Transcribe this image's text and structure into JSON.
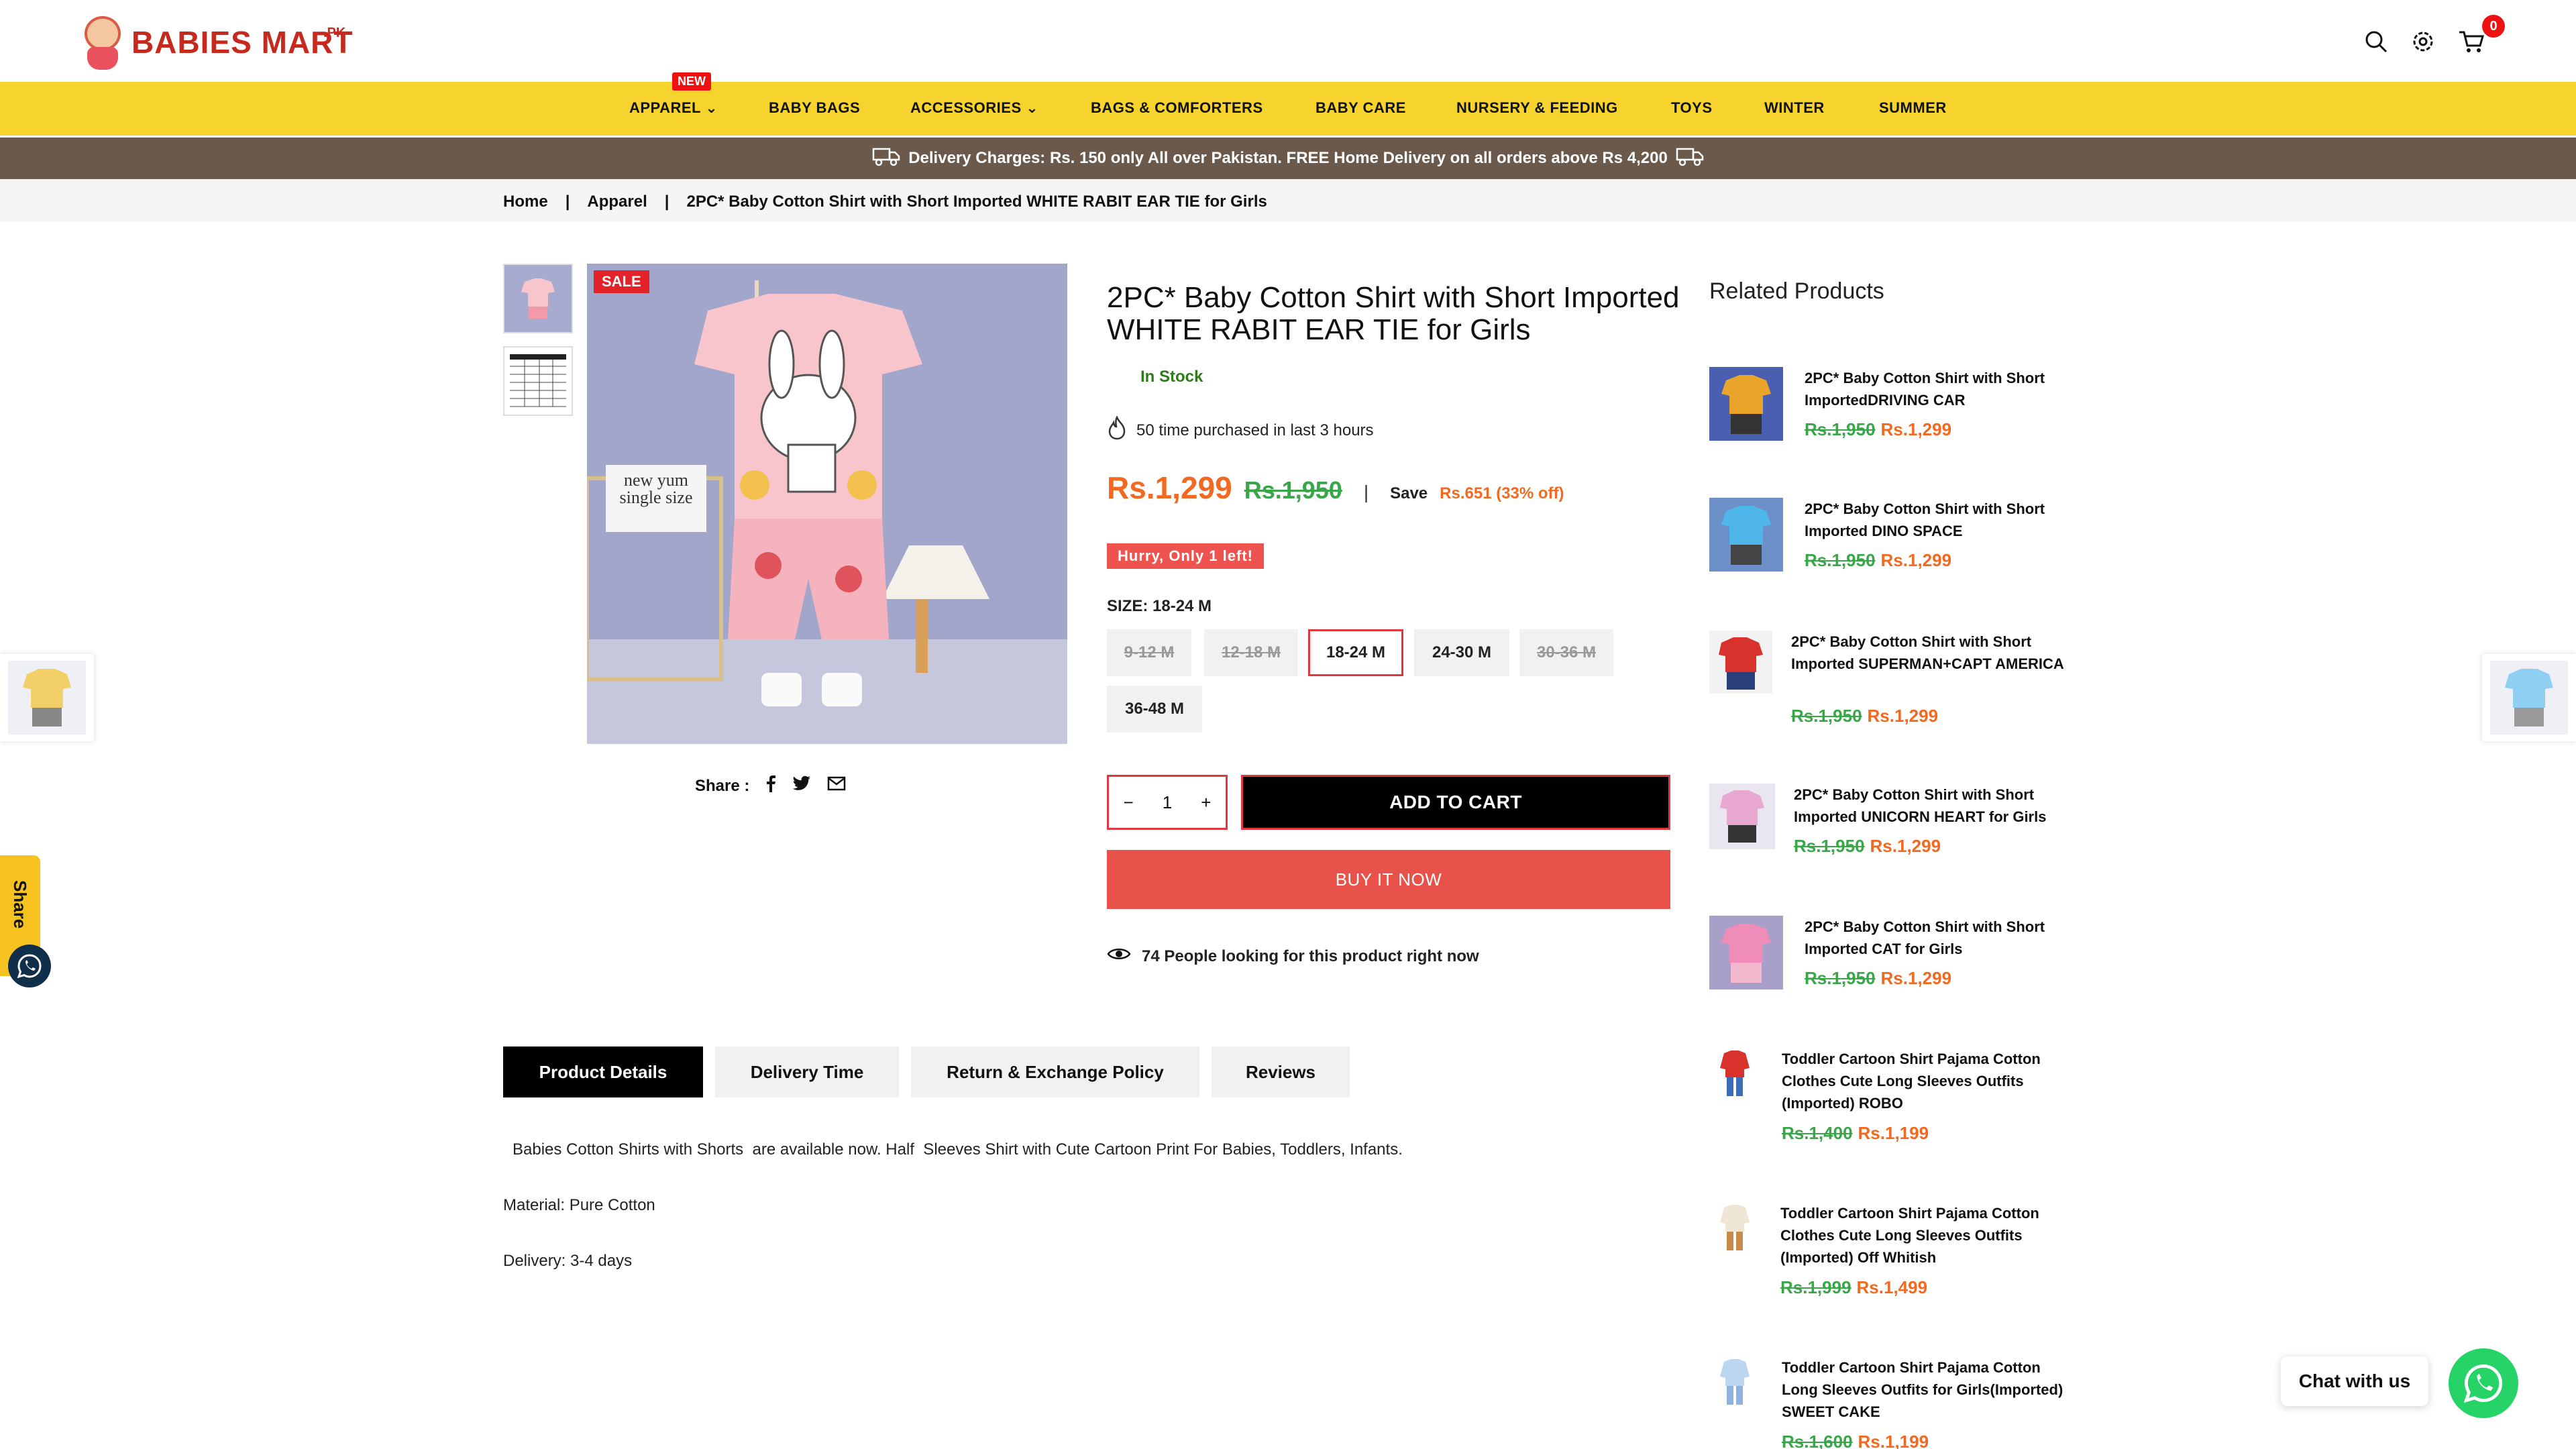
{
  "header": {
    "logo_text": "BABIES MART",
    "logo_suffix": ".PK",
    "cart_count": "0"
  },
  "nav": {
    "items": [
      "APPAREL",
      "BABY BAGS",
      "ACCESSORIES",
      "BAGS & COMFORTERS",
      "BABY CARE",
      "NURSERY & FEEDING",
      "TOYS",
      "WINTER",
      "SUMMER"
    ],
    "new_badge": "NEW"
  },
  "delivery_text": "Delivery Charges: Rs. 150 only All over Pakistan. FREE Home Delivery on all orders above Rs 4,200",
  "breadcrumb": {
    "home": "Home",
    "sep": "|",
    "category": "Apparel",
    "current": "2PC* Baby Cotton Shirt with Short Imported WHITE RABIT EAR TIE for Girls"
  },
  "gallery": {
    "sale_badge": "SALE",
    "share_label": "Share :",
    "sign_text": "new yum single size"
  },
  "product": {
    "title": "2PC* Baby Cotton Shirt with Short Imported WHITE RABIT EAR TIE for Girls",
    "stock": "In Stock",
    "purchased": "50 time purchased in last 3 hours",
    "price_now": "Rs.1,299",
    "price_was": "Rs.1,950",
    "price_sep": "|",
    "save_label": "Save",
    "save_amount": "Rs.651 (33% off)",
    "hurry": "Hurry, Only 1 left!",
    "size_label": "SIZE: 18-24 M",
    "sizes": [
      "9-12 M",
      "12-18 M",
      "18-24 M",
      "24-30 M",
      "30-36 M",
      "36-48 M"
    ],
    "selected_size": "18-24 M",
    "qty": "1",
    "minus": "−",
    "plus": "+",
    "add_to_cart": "ADD TO CART",
    "buy_now": "BUY IT NOW",
    "looking": "74 People looking for this product right now"
  },
  "tabs": [
    "Product Details",
    "Delivery Time",
    "Return & Exchange Policy",
    "Reviews"
  ],
  "description": {
    "line1": "Babies Cotton Shirts with Shorts  are available now. Half  Sleeves Shirt with Cute Cartoon Print For Babies, Toddlers, Infants.",
    "line2": "Material: Pure Cotton",
    "line3": "Delivery: 3-4 days"
  },
  "related": {
    "title": "Related Products",
    "items": [
      {
        "name": "2PC* Baby Cotton Shirt with Short ImportedDRIVING CAR",
        "was": "Rs.1,950",
        "now": "Rs.1,299"
      },
      {
        "name": "2PC* Baby Cotton Shirt with Short Imported DINO SPACE",
        "was": "Rs.1,950",
        "now": "Rs.1,299"
      },
      {
        "name": "2PC* Baby Cotton Shirt with Short Imported SUPERMAN+CAPT AMERICA",
        "was": "Rs.1,950",
        "now": "Rs.1,299"
      },
      {
        "name": "2PC* Baby Cotton Shirt with Short Imported UNICORN HEART for Girls",
        "was": "Rs.1,950",
        "now": "Rs.1,299"
      },
      {
        "name": "2PC* Baby Cotton Shirt with Short Imported CAT for Girls",
        "was": "Rs.1,950",
        "now": "Rs.1,299"
      },
      {
        "name": "Toddler Cartoon Shirt Pajama Cotton Clothes Cute Long Sleeves Outfits (Imported) ROBO",
        "was": "Rs.1,400",
        "now": "Rs.1,199"
      },
      {
        "name": "Toddler Cartoon Shirt Pajama Cotton Clothes Cute Long Sleeves Outfits (Imported) Off Whitish",
        "was": "Rs.1,999",
        "now": "Rs.1,499"
      },
      {
        "name": "Toddler Cartoon Shirt Pajama Cotton Long Sleeves Outfits for Girls(Imported) SWEET CAKE",
        "was": "Rs.1,600",
        "now": "Rs.1,199"
      }
    ]
  },
  "floating": {
    "share_tab": "Share",
    "chat": "Chat with us"
  },
  "colors": {
    "nav_bg": "#f6d32d",
    "delivery_bg": "#6b5a4c",
    "accent_orange": "#f26a21",
    "strike_green": "#3aa64a",
    "sale_red": "#e4222a",
    "buy_now": "#e9524a",
    "whatsapp": "#25d366"
  },
  "icons": [
    "search-icon",
    "gear-icon",
    "cart-icon",
    "truck-icon",
    "fire-icon",
    "facebook-icon",
    "twitter-icon",
    "mail-icon",
    "eye-icon",
    "whatsapp-icon",
    "chevron-down-icon"
  ]
}
